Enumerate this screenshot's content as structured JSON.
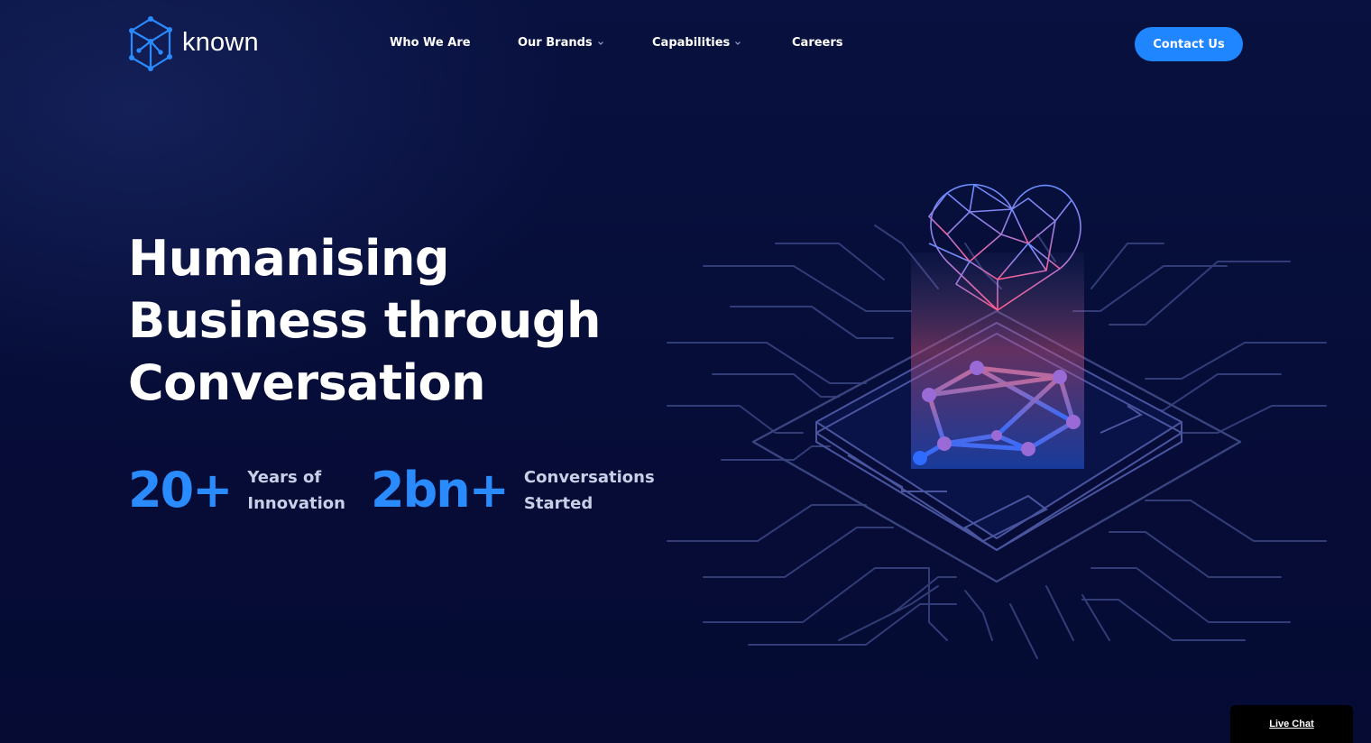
{
  "brand": {
    "name": "known",
    "logo_icon": "cube-network-icon",
    "accent_color": "#1f86ff"
  },
  "nav": {
    "items": [
      {
        "label": "Who We Are",
        "has_dropdown": false
      },
      {
        "label": "Our Brands",
        "has_dropdown": true
      },
      {
        "label": "Capabilities",
        "has_dropdown": true
      },
      {
        "label": "Careers",
        "has_dropdown": false
      }
    ],
    "contact_label": "Contact Us"
  },
  "hero": {
    "headline": [
      "Humanising",
      "Business through",
      "Conversation"
    ],
    "stats": [
      {
        "value": "20+",
        "label": [
          "Years of",
          "Innovation"
        ]
      },
      {
        "value": "2bn+",
        "label": [
          "Conversations",
          "Started"
        ]
      }
    ],
    "illustration": "circuit-chip-heart-illustration"
  },
  "chat": {
    "label": "Live Chat"
  },
  "colors": {
    "background": "#060d38",
    "stat_blue": "#2a8bff",
    "circuit_line": "#3a4580",
    "heart_top": "#6a8cff",
    "heart_bottom": "#ff5d8f"
  }
}
